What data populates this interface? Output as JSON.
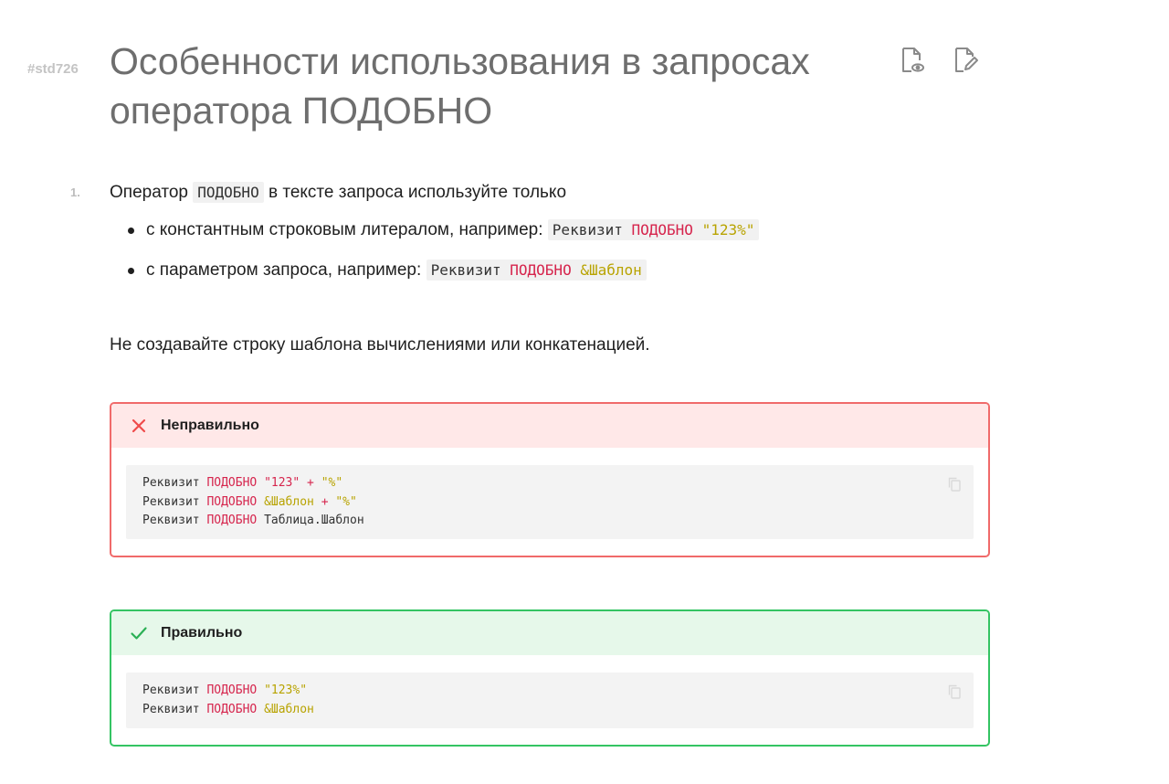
{
  "header": {
    "tag": "#std726",
    "title": "Особенности использования в запросах оператора ПОДОБНО",
    "icons": [
      "view-document-icon",
      "edit-document-icon"
    ]
  },
  "rule": {
    "number": "1.",
    "intro": {
      "before": "Оператор ",
      "keyword": "ПОДОБНО",
      "after": " в тексте запроса используйте только"
    },
    "bullets": [
      {
        "text": "с константным строковым литералом, например: ",
        "code": {
          "ident": "Реквизит",
          "keyword": "ПОДОБНО",
          "value": "\"123%\""
        }
      },
      {
        "text": "с параметром запроса, например: ",
        "code": {
          "ident": "Реквизит",
          "keyword": "ПОДОБНО",
          "value": "&Шаблон"
        }
      }
    ],
    "note": "Не создавайте строку шаблона вычислениями или конкатенацией."
  },
  "wrong_panel": {
    "label": "Неправильно",
    "icon": "cross-icon",
    "lines": [
      {
        "ident": "Реквизит",
        "keyword": "ПОДОБНО",
        "a": "\"123\"",
        "op": "+",
        "b": "\"%\""
      },
      {
        "ident": "Реквизит",
        "keyword": "ПОДОБНО",
        "a": "&Шаблон",
        "op": "+",
        "b": "\"%\""
      },
      {
        "ident": "Реквизит",
        "keyword": "ПОДОБНО",
        "rest": "Таблица.Шаблон"
      }
    ]
  },
  "right_panel": {
    "label": "Правильно",
    "icon": "check-icon",
    "lines": [
      {
        "ident": "Реквизит",
        "keyword": "ПОДОБНО",
        "value": "\"123%\""
      },
      {
        "ident": "Реквизит",
        "keyword": "ПОДОБНО",
        "value": "&Шаблон"
      }
    ]
  },
  "colors": {
    "keyword": "#d6254d",
    "string": "#b8a300",
    "wrong_border": "#f06a6a",
    "wrong_header": "#ffe8e8",
    "right_border": "#34c463",
    "right_header": "#e6f8ea"
  }
}
